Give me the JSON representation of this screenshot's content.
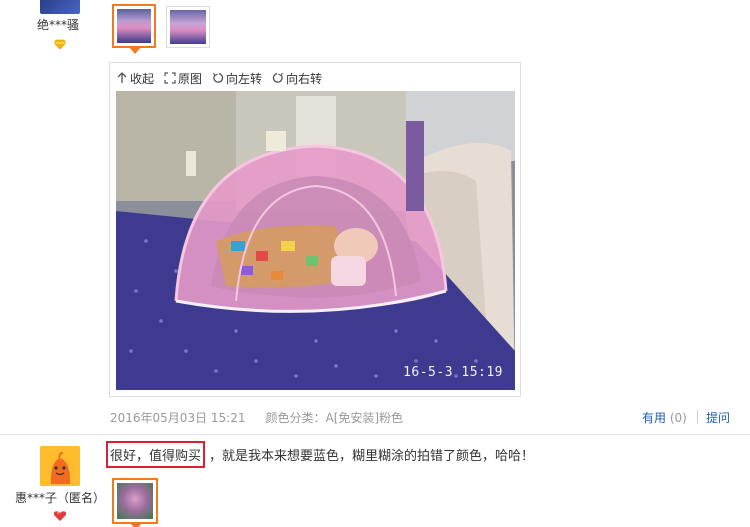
{
  "review1": {
    "username": "绝***骚",
    "rank_icon": "diamond-icon",
    "photo_timestamp": "16-5-3 15:19",
    "toolbar": {
      "collapse": "收起",
      "original": "原图",
      "rotate_left": "向左转",
      "rotate_right": "向右转"
    },
    "meta": {
      "date": "2016年05月03日 15:21",
      "variant": "颜色分类：A[免安装]粉色"
    },
    "useful_label": "有用",
    "useful_count": "(0)",
    "reply_label": "提问"
  },
  "review2": {
    "username": "惠***子（匿名）",
    "rank_icon": "heart-icon",
    "comment_highlight": "很好，值得购买",
    "comment_rest": "，就是我本来想要蓝色，糊里糊涂的拍错了颜色，哈哈！"
  },
  "colors": {
    "accent_orange": "#f07a1c",
    "link_blue": "#1f5ea8",
    "highlight_red": "#d9232e",
    "meta_gray": "#999999"
  }
}
